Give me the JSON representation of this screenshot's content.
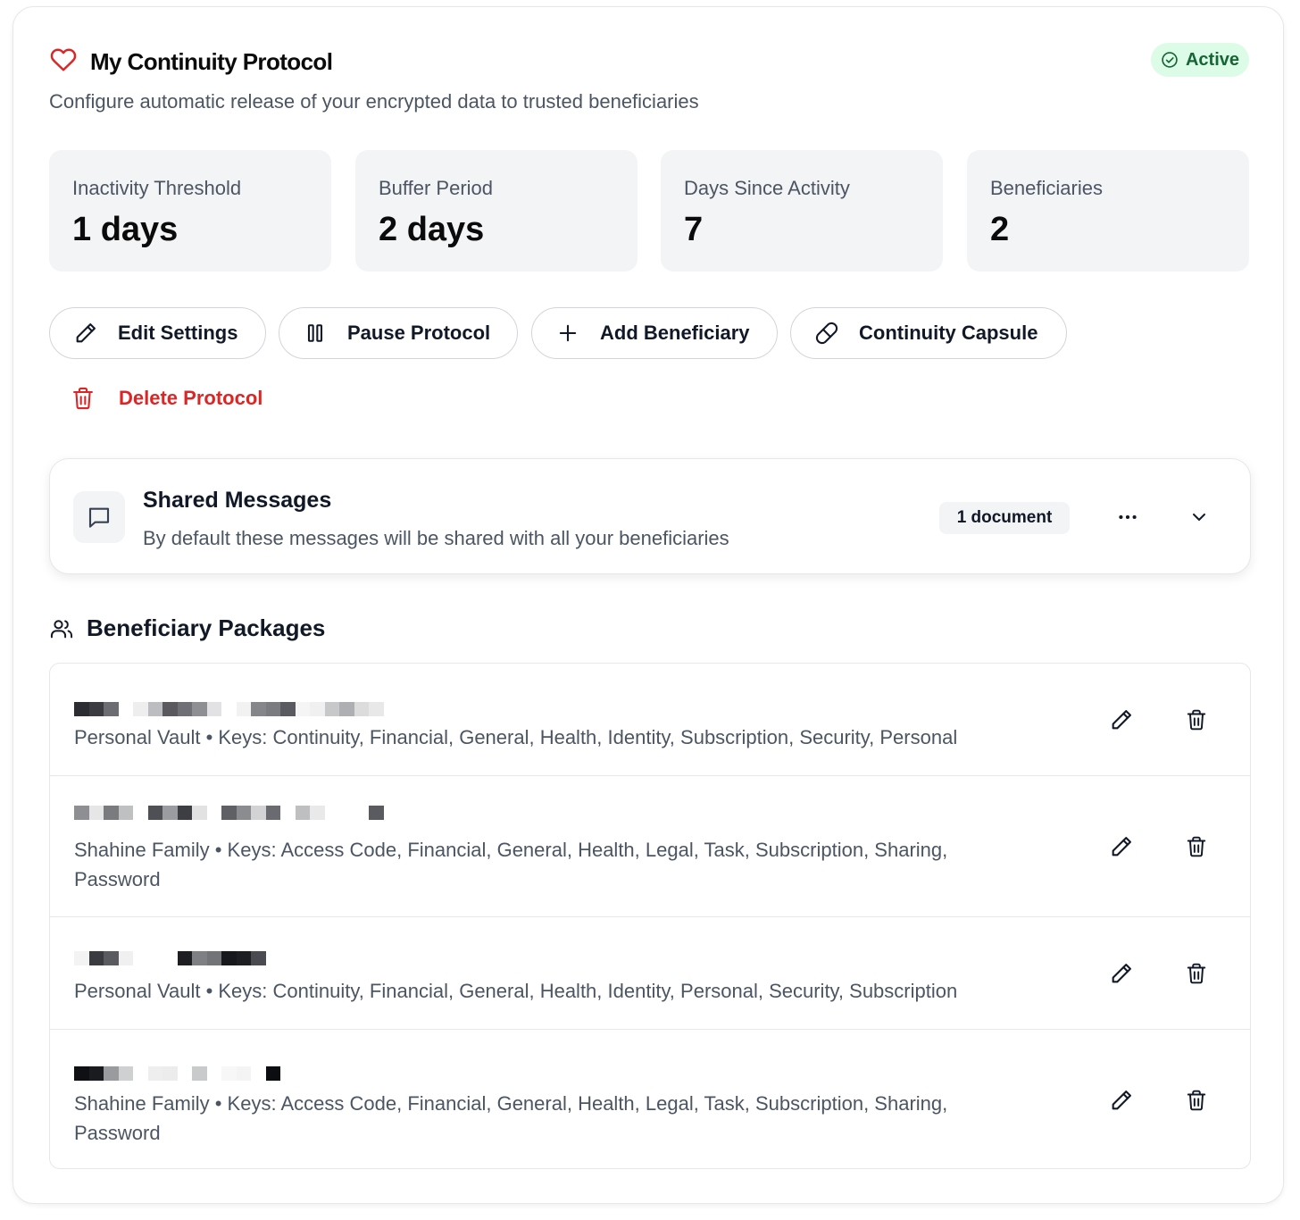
{
  "header": {
    "title": "My Continuity Protocol",
    "subtitle": "Configure automatic release of your encrypted data to trusted beneficiaries",
    "status": "Active",
    "accent_color": "#dc2626",
    "status_color": "#166534"
  },
  "stats": [
    {
      "label": "Inactivity Threshold",
      "value": "1 days"
    },
    {
      "label": "Buffer Period",
      "value": "2 days"
    },
    {
      "label": "Days Since Activity",
      "value": "7"
    },
    {
      "label": "Beneficiaries",
      "value": "2"
    }
  ],
  "actions": {
    "edit_settings": {
      "label": "Edit Settings",
      "icon": "pencil-icon"
    },
    "pause_protocol": {
      "label": "Pause Protocol",
      "icon": "pause-icon"
    },
    "add_beneficiary": {
      "label": "Add Beneficiary",
      "icon": "plus-icon"
    },
    "continuity_capsule": {
      "label": "Continuity Capsule",
      "icon": "pill-icon"
    },
    "delete_protocol": {
      "label": "Delete Protocol",
      "icon": "trash-icon"
    }
  },
  "shared_messages": {
    "title": "Shared Messages",
    "description": "By default these messages will be shared with all your beneficiaries",
    "badge": "1 document"
  },
  "packages": {
    "heading": "Beneficiary Packages",
    "items": [
      {
        "name_redacted": true,
        "description": "Personal Vault • Keys: Continuity, Financial, General, Health, Identity, Subscription, Security, Personal"
      },
      {
        "name_redacted": true,
        "description": "Shahine Family • Keys: Access Code, Financial, General, Health, Legal, Task, Subscription, Sharing, Password"
      },
      {
        "name_redacted": true,
        "description": "Personal Vault • Keys: Continuity, Financial, General, Health, Identity, Personal, Security, Subscription"
      },
      {
        "name_redacted": true,
        "description": "Shahine Family • Keys: Access Code, Financial, General, Health, Legal, Task, Subscription, Sharing, Password"
      }
    ]
  }
}
